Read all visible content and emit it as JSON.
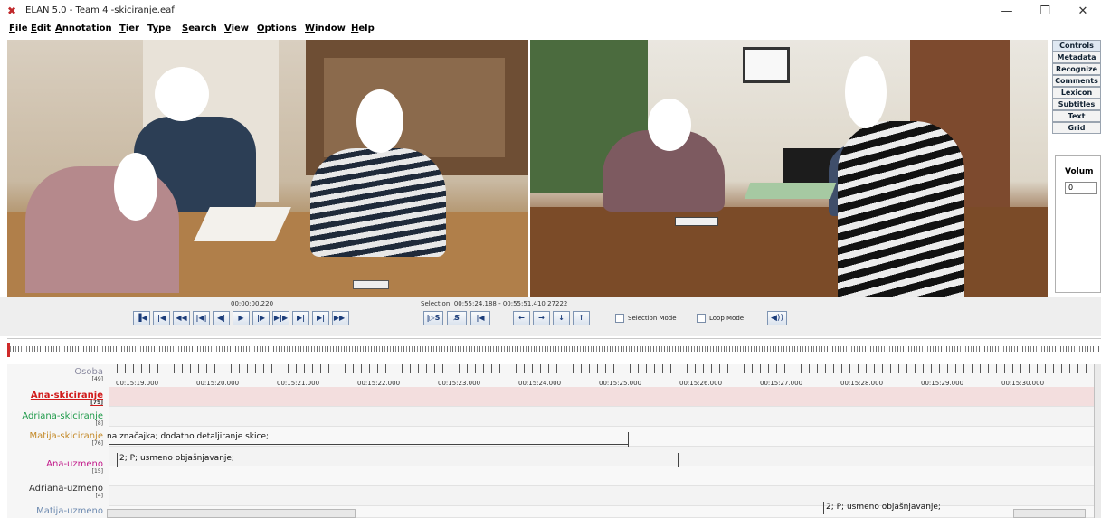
{
  "window": {
    "title": "ELAN 5.0 - Team 4 -skiciranje.eaf",
    "min_glyph": "—",
    "max_glyph": "❐",
    "close_glyph": "✕"
  },
  "menu": [
    {
      "label": "File",
      "u": "F"
    },
    {
      "label": "Edit",
      "u": "E"
    },
    {
      "label": "Annotation",
      "u": "A"
    },
    {
      "label": "Tier",
      "u": "T"
    },
    {
      "label": "Type",
      "u": "y"
    },
    {
      "label": "Search",
      "u": "S"
    },
    {
      "label": "View",
      "u": "V"
    },
    {
      "label": "Options",
      "u": "O"
    },
    {
      "label": "Window",
      "u": "W"
    },
    {
      "label": "Help",
      "u": "H"
    }
  ],
  "side_tabs": [
    "Controls",
    "Metadata",
    "Recognize",
    "Comments",
    "Lexicon",
    "Subtitles",
    "Text",
    "Grid"
  ],
  "side_panel": {
    "volume_label": "Volum",
    "volume_value": "0"
  },
  "player": {
    "time": "00:00:00.220",
    "selection": "Selection: 00:55:24.188 - 00:55:51.410  27222",
    "buttons": [
      "▐◀",
      "|◀",
      "◀◀",
      "|◀|",
      "◀|",
      "▶",
      "|▶",
      "▶|▶",
      "▶|",
      "▶|",
      "▶▶|"
    ],
    "sel_buttons": [
      "|▷S",
      "S̸",
      "|◀"
    ],
    "arrows": [
      "←",
      "→",
      "↓",
      "↑"
    ],
    "selection_mode_label": "Selection Mode",
    "loop_mode_label": "Loop Mode",
    "speaker": "◀))"
  },
  "ruler": {
    "labels": [
      "00:15:19.000",
      "00:15:20.000",
      "00:15:21.000",
      "00:15:22.000",
      "00:15:23.000",
      "00:15:24.000",
      "00:15:25.000",
      "00:15:26.000",
      "00:15:27.000",
      "00:15:28.000",
      "00:15:29.000",
      "00:15:30.000"
    ]
  },
  "tiers": [
    {
      "name": "Osoba",
      "count": "[49]",
      "color": "#8a8aa0"
    },
    {
      "name": "Ana-skiciranje",
      "count": "[79]",
      "color": "#d11a1a"
    },
    {
      "name": "Adriana-skiciranje",
      "count": "[8]",
      "color": "#1f9a4a"
    },
    {
      "name": "Matija-skiciranje",
      "count": "[76]",
      "color": "#c48a2a"
    },
    {
      "name": "Ana-uzmeno",
      "count": "[15]",
      "color": "#c21a8a"
    },
    {
      "name": "Adriana-uzmeno",
      "count": "[4]",
      "color": "#333333"
    },
    {
      "name": "Matija-uzmeno",
      "count": "",
      "color": "#6d8ab0"
    }
  ],
  "annotations": {
    "matija": "na značajka; dodatno detaljiranje skice;",
    "ana_uzmeno": "2; P; usmeno objašnjavanje;",
    "matija_uzmeno": "2; P; usmeno objašnjavanje;"
  },
  "colors": {
    "active_tier_bg": "#f3dede",
    "accent_blue": "#1c3d7a"
  }
}
